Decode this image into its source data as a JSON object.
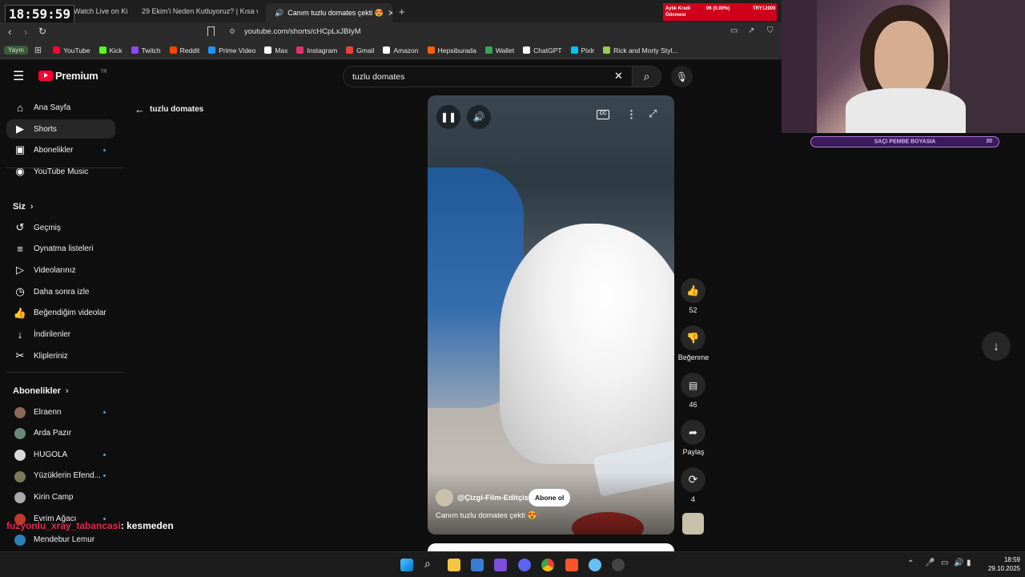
{
  "overlay": {
    "clock": "18:59:59",
    "chat_user": "fuzyonlu_xray_tabancasi",
    "chat_message": ": kesmeden",
    "banner_left": "Aylık Kredi Ödemesi",
    "banner_mid": "06 (0.00%)",
    "banner_right": "TRY12000",
    "cam_bar_text": "SAÇI PEMBE BOYASIA",
    "cam_bar_count": "30"
  },
  "browser": {
    "tabs": [
      {
        "label": "Watch Live on Ki"
      },
      {
        "label": "29 Ekim'i Neden Kutluyoruz? | Kısa v"
      },
      {
        "label": "Canım tuzlu domates çekti 😍"
      }
    ],
    "new_tab": "+",
    "url": "youtube.com/shorts/cHCpLxJBIyM",
    "bookmarks": [
      {
        "label": "YouTube",
        "color": "#ff0033"
      },
      {
        "label": "Kick",
        "color": "#53fc18"
      },
      {
        "label": "Twitch",
        "color": "#9146ff"
      },
      {
        "label": "Reddit",
        "color": "#ff4500"
      },
      {
        "label": "Prime Video",
        "color": "#1a98ff"
      },
      {
        "label": "Max",
        "color": "#ffffff"
      },
      {
        "label": "Instagram",
        "color": "#e1306c"
      },
      {
        "label": "Gmail",
        "color": "#ea4335"
      },
      {
        "label": "Amazon",
        "color": "#ffffff"
      },
      {
        "label": "Hepsiburada",
        "color": "#ff6000"
      },
      {
        "label": "Wallet",
        "color": "#34a853"
      },
      {
        "label": "ChatGPT",
        "color": "#ffffff"
      },
      {
        "label": "Pixlr",
        "color": "#00c2ff"
      },
      {
        "label": "Rick and Morty Styl...",
        "color": "#97ce4c"
      }
    ],
    "profile_badge": "Yayın"
  },
  "youtube": {
    "logo": "Premium",
    "logo_sup": "TR",
    "search_value": "tuzlu domates",
    "back_label": "tuzlu domates",
    "sidebar_main": [
      {
        "label": "Ana Sayfa",
        "icon": "home-icon",
        "glyph": "⌂"
      },
      {
        "label": "Shorts",
        "icon": "shorts-icon",
        "glyph": "▶"
      },
      {
        "label": "Abonelikler",
        "icon": "subscriptions-icon",
        "glyph": "▣"
      },
      {
        "label": "YouTube Music",
        "icon": "music-icon",
        "glyph": "◉"
      }
    ],
    "you_heading": "Siz",
    "sidebar_you": [
      {
        "label": "Geçmiş",
        "icon": "history-icon",
        "glyph": "↺"
      },
      {
        "label": "Oynatma listeleri",
        "icon": "playlists-icon",
        "glyph": "≡"
      },
      {
        "label": "Videolarınız",
        "icon": "your-videos-icon",
        "glyph": "▷"
      },
      {
        "label": "Daha sonra izle",
        "icon": "watch-later-icon",
        "glyph": "◷"
      },
      {
        "label": "Beğendiğim videolar",
        "icon": "liked-icon",
        "glyph": "👍"
      },
      {
        "label": "İndirilenler",
        "icon": "downloads-icon",
        "glyph": "↓"
      },
      {
        "label": "Klipleriniz",
        "icon": "clips-icon",
        "glyph": "✂"
      }
    ],
    "subs_heading": "Abonelikler",
    "subscriptions": [
      {
        "label": "Elraenn",
        "color": "#8a6a55"
      },
      {
        "label": "Arda Pazır",
        "color": "#6a8a7a"
      },
      {
        "label": "HUGOLA",
        "color": "#d9d9d9"
      },
      {
        "label": "Yüzüklerin Efend...",
        "color": "#7a7a5a"
      },
      {
        "label": "Kirin Camp",
        "color": "#aaaaaa"
      },
      {
        "label": "Evrim Ağacı",
        "color": "#c0392b"
      },
      {
        "label": "Mendebur Lemur",
        "color": "#2980b9"
      }
    ],
    "short": {
      "channel": "@Çizgi-Film-Editçisi",
      "subscribe": "Abone ol",
      "title": "Canım tuzlu domates çekti 😍",
      "likes": "52",
      "dislike_label": "Beğenme",
      "comments": "46",
      "share_label": "Paylaş",
      "remix_count": "4"
    }
  },
  "taskbar": {
    "time": "18:59",
    "date": "29.10.2025"
  }
}
